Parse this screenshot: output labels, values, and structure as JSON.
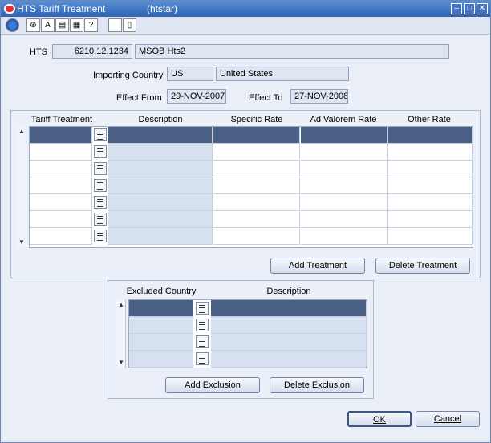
{
  "window": {
    "title": "HTS Tariff Treatment",
    "code": "(htstar)"
  },
  "form": {
    "hts_label": "HTS",
    "hts_code": "6210.12.1234",
    "hts_desc": "MSOB Hts2",
    "importing_country_label": "Importing Country",
    "importing_country_code": "US",
    "importing_country_name": "United States",
    "effect_from_label": "Effect From",
    "effect_from": "29-NOV-2007",
    "effect_to_label": "Effect To",
    "effect_to": "27-NOV-2008"
  },
  "tariff_grid": {
    "headers": [
      "Tariff Treatment",
      "Description",
      "Specific Rate",
      "Ad Valorem Rate",
      "Other Rate"
    ]
  },
  "buttons": {
    "add_treatment": "Add Treatment",
    "add_treatment_key": "d",
    "delete_treatment": "Delete Treatment",
    "add_exclusion": "Add Exclusion",
    "delete_exclusion": "Delete Exclusion",
    "ok": "OK",
    "cancel": "Cancel"
  },
  "exclusion_grid": {
    "headers": [
      "Excluded Country",
      "Description"
    ]
  },
  "toolbar": {
    "icons": [
      "globe-icon",
      "help-icon",
      "spell-icon",
      "notes-icon",
      "print-icon",
      "question-icon",
      "blank-icon",
      "doc-icon"
    ]
  }
}
